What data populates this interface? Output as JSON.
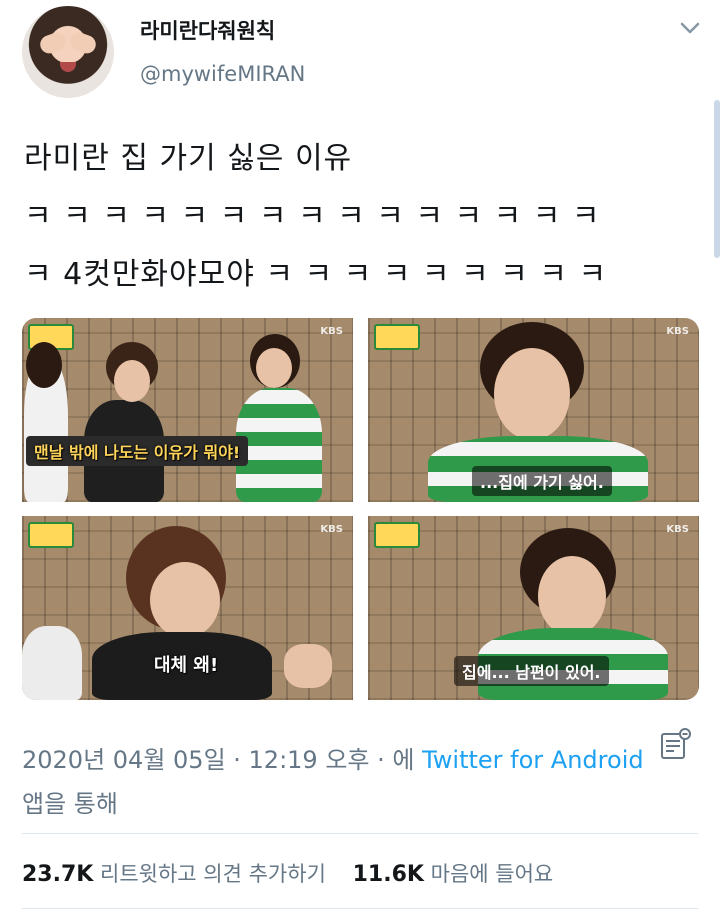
{
  "author": {
    "display_name": "라미란다줘원칙",
    "handle": "@mywifeMIRAN",
    "avatar_icon": "profile-photo"
  },
  "tweet": {
    "lines": [
      "라미란 집 가기 싫은 이유",
      "ㅋ ㅋ ㅋ ㅋ ㅋ ㅋ ㅋ ㅋ ㅋ ㅋ ㅋ ㅋ ㅋ ㅋ ㅋ",
      "ㅋ 4컷만화야모야 ㅋ ㅋ ㅋ ㅋ ㅋ ㅋ ㅋ ㅋ ㅋ"
    ]
  },
  "media": {
    "panels": [
      {
        "subtitle": "맨날 밖에 나도는 이유가 뭐야!",
        "broadcaster": "KBS"
      },
      {
        "subtitle": "...집에 가기 싫어.",
        "broadcaster": "KBS"
      },
      {
        "subtitle": "대체 왜!",
        "broadcaster": "KBS"
      },
      {
        "subtitle": "집에... 남편이 있어.",
        "broadcaster": "KBS"
      }
    ]
  },
  "meta": {
    "timestamp": "2020년 04월 05일 · 12:19 오후 · 에",
    "source_link": "Twitter for Android",
    "suffix": "앱을 통해"
  },
  "stats": {
    "retweets_count": "23.7K",
    "retweets_label": "리트윗하고 의견 추가하기",
    "likes_count": "11.6K",
    "likes_label": "마음에 들어요"
  },
  "colors": {
    "accent": "#1da1f2",
    "secondary_text": "#657786",
    "primary_text": "#14171a",
    "divider": "#e1e8ed"
  }
}
